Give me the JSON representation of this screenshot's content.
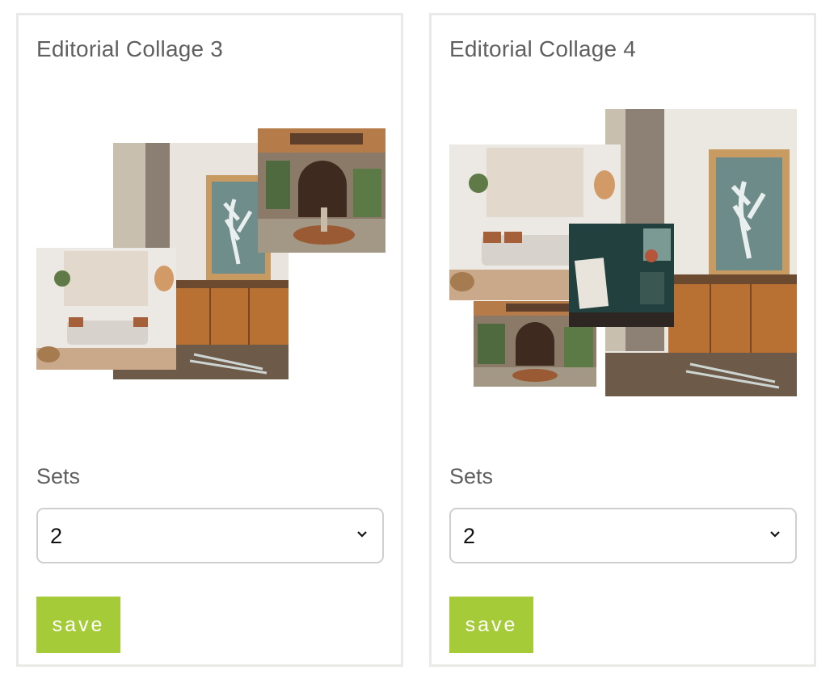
{
  "cards": [
    {
      "title": "Editorial Collage 3",
      "sets_label": "Sets",
      "sets_value": "2",
      "save_label": "save"
    },
    {
      "title": "Editorial Collage 4",
      "sets_label": "Sets",
      "sets_value": "2",
      "save_label": "save"
    }
  ],
  "colors": {
    "accent": "#a6cb39",
    "card_border": "#e9e9e7",
    "select_border": "#cfcfcf",
    "text": "#5f5f5f"
  },
  "icons": {
    "select_caret": "chevron-down-icon"
  }
}
